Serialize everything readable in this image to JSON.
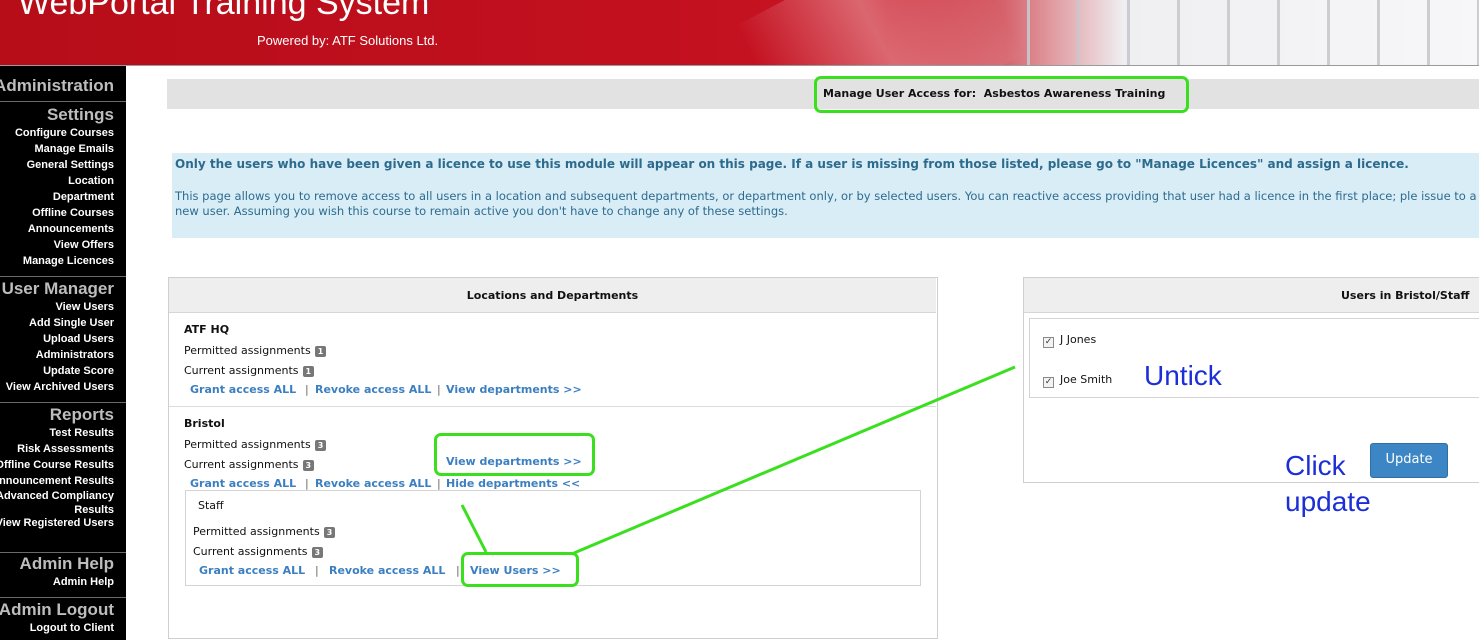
{
  "header": {
    "title": "WebPortal Training System",
    "subtitle": "Powered by: ATF Solutions Ltd."
  },
  "sidebar": {
    "sections": [
      {
        "heading": "Administration",
        "items": []
      },
      {
        "heading": "Settings",
        "items": [
          "Configure Courses",
          "Manage Emails",
          "General Settings",
          "Location",
          "Department",
          "Offline Courses",
          "Announcements",
          "View Offers",
          "Manage Licences"
        ]
      },
      {
        "heading": "User Manager",
        "items": [
          "View Users",
          "Add Single User",
          "Upload Users",
          "Administrators",
          "Update Score",
          "View Archived Users"
        ]
      },
      {
        "heading": "Reports",
        "items": [
          "Test Results",
          "Risk Assessments",
          "Offline Course Results",
          "Announcement Results",
          "Advanced Compliancy Results",
          "View Registered Users"
        ]
      },
      {
        "heading": "Admin Help",
        "items": [
          "Admin Help"
        ]
      },
      {
        "heading": "Admin Logout",
        "items": [
          "Logout to Client"
        ]
      }
    ]
  },
  "page": {
    "title_label": "Manage User Access for:",
    "course_name": "Asbestos Awareness Training"
  },
  "info": {
    "bold": "Only the users who have been given a licence to use this module will appear on this page. If a user is missing from those listed, please go to \"Manage Licences\" and assign a licence.",
    "normal": "This page allows you to remove access to all users in a location and subsequent departments, or department only, or by selected users. You can reactive access providing that user had a licence in the first place; ple issue to a new user. Assuming you wish this course to remain active you don't have to change any of these settings."
  },
  "locations_panel": {
    "heading": "Locations and Departments",
    "permitted_label": "Permitted assignments",
    "current_label": "Current assignments",
    "grant_all": "Grant access ALL",
    "revoke_all": "Revoke access ALL",
    "view_departments": "View departments >>",
    "hide_departments": "Hide departments <<",
    "view_users": "View Users >>",
    "separator": "|",
    "locations": [
      {
        "name": "ATF HQ",
        "permitted": "1",
        "current": "1"
      },
      {
        "name": "Bristol",
        "permitted": "3",
        "current": "3",
        "departments": [
          {
            "name": "Staff",
            "permitted": "3",
            "current": "3"
          }
        ]
      }
    ]
  },
  "users_panel": {
    "heading": "Users in Bristol/Staff",
    "users": [
      {
        "name": "J Jones",
        "checked": true
      },
      {
        "name": "Joe Smith",
        "checked": true
      }
    ],
    "update_button": "Update"
  },
  "annotations": {
    "untick": "Untick",
    "click_update_line1": "Click",
    "click_update_line2": "update",
    "color": "#1c2fd6",
    "highlight_color": "#3adf1e"
  }
}
